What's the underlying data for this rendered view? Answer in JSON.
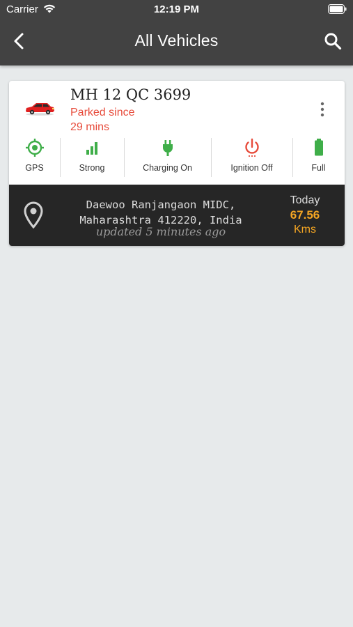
{
  "status_bar": {
    "carrier": "Carrier",
    "time": "12:19 PM"
  },
  "nav": {
    "title": "All Vehicles",
    "back_icon": "chevron-left-icon",
    "search_icon": "search-icon"
  },
  "vehicle": {
    "plate": "MH 12 QC 3699",
    "status_line1": "Parked since",
    "status_line2": "29 mins",
    "status_color": "#e74c3c",
    "icon": "car-icon",
    "indicators": [
      {
        "label": "GPS",
        "icon": "gps-target-icon",
        "color": "#3fae49"
      },
      {
        "label": "Strong",
        "icon": "signal-bars-icon",
        "color": "#3fae49"
      },
      {
        "label": "Charging On",
        "icon": "plug-icon",
        "color": "#3fae49"
      },
      {
        "label": "Ignition Off",
        "icon": "power-icon",
        "color": "#e74c3c"
      },
      {
        "label": "Full",
        "icon": "battery-icon",
        "color": "#3fae49"
      }
    ],
    "location": {
      "address_line1": "Daewoo Ranjangaon MIDC,",
      "address_line2": "Maharashtra 412220, India",
      "updated": "updated 5 minutes ago"
    },
    "distance": {
      "label": "Today",
      "value": "67.56",
      "unit": "Kms",
      "color": "#f5a623"
    }
  }
}
